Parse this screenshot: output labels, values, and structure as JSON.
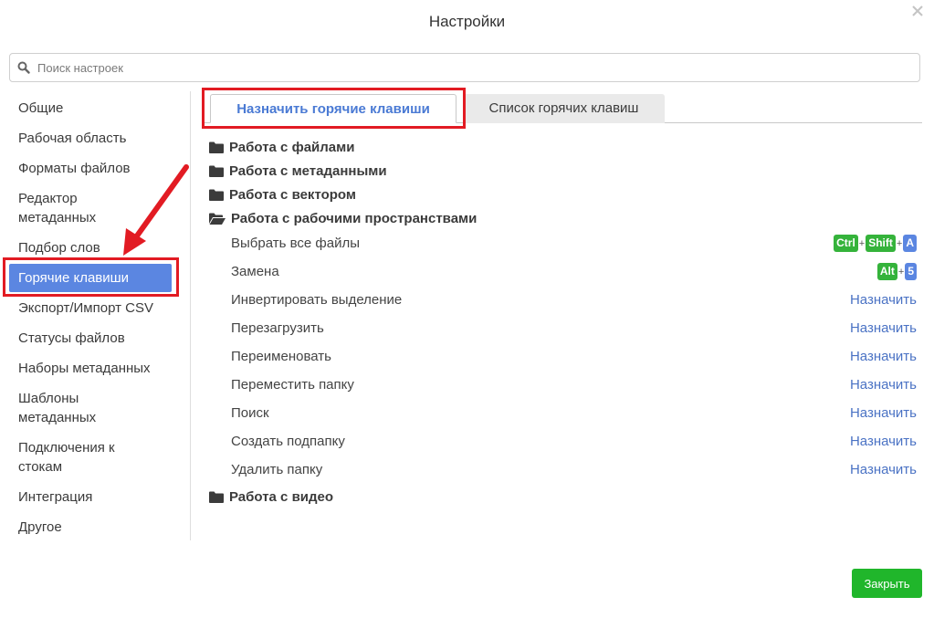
{
  "dialog": {
    "title": "Настройки",
    "close_button": "Закрыть"
  },
  "search": {
    "placeholder": "Поиск настроек",
    "value": ""
  },
  "sidebar": {
    "items": [
      {
        "label": "Общие"
      },
      {
        "label": "Рабочая область"
      },
      {
        "label": "Форматы файлов"
      },
      {
        "label": "Редактор\nметаданных"
      },
      {
        "label": "Подбор слов"
      },
      {
        "label": "Горячие клавиши",
        "active": true
      },
      {
        "label": "Экспорт/Импорт CSV"
      },
      {
        "label": "Статусы файлов"
      },
      {
        "label": "Наборы метаданных"
      },
      {
        "label": "Шаблоны\nметаданных"
      },
      {
        "label": "Подключения к\nстокам"
      },
      {
        "label": "Интеграция"
      },
      {
        "label": "Другое"
      }
    ]
  },
  "tabs": [
    {
      "label": "Назначить горячие клавиши",
      "active": true
    },
    {
      "label": "Список горячих клавиш",
      "active": false
    }
  ],
  "groups": [
    {
      "label": "Работа с файлами",
      "icon": "folder-icon"
    },
    {
      "label": "Работа с метаданными",
      "icon": "folder-icon"
    },
    {
      "label": "Работа с вектором",
      "icon": "folder-icon"
    },
    {
      "label": "Работа с рабочими пространствами",
      "icon": "folder-open-icon"
    },
    {
      "label": "Работа с видео",
      "icon": "folder-icon"
    }
  ],
  "actions": [
    {
      "label": "Выбрать все файлы",
      "keys": [
        "Ctrl",
        "Shift",
        "A"
      ]
    },
    {
      "label": "Замена",
      "keys": [
        "Alt",
        "5"
      ]
    },
    {
      "label": "Инвертировать выделение",
      "assign": "Назначить"
    },
    {
      "label": "Перезагрузить",
      "assign": "Назначить"
    },
    {
      "label": "Переименовать",
      "assign": "Назначить"
    },
    {
      "label": "Переместить папку",
      "assign": "Назначить"
    },
    {
      "label": "Поиск",
      "assign": "Назначить"
    },
    {
      "label": "Создать подпапку",
      "assign": "Назначить"
    },
    {
      "label": "Удалить папку",
      "assign": "Назначить"
    }
  ],
  "colors": {
    "accent": "#5b86e1",
    "tab_active_text": "#4a7ad4",
    "link": "#4a72c4",
    "key_modifier": "#35b33b",
    "key_main": "#5b86e1",
    "primary_button": "#20b62b",
    "highlight_frame": "#e21b23"
  }
}
